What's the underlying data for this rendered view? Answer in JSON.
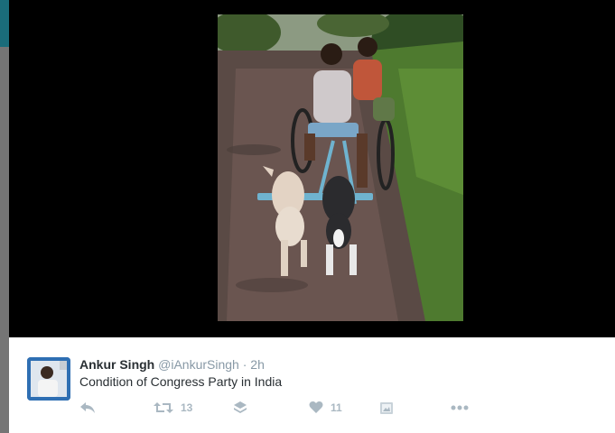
{
  "colors": {
    "backdrop": "#6e6e6e",
    "accent_strip": "#1a6c7a",
    "media_bg": "#000000",
    "tweet_bg": "#ffffff",
    "name_text": "#292f33",
    "meta_text": "#8899a6",
    "action_icon": "#aab8c2"
  },
  "tweet": {
    "author_name": "Ankur Singh",
    "handle": "@iAnkurSingh",
    "separator": "·",
    "time": "2h",
    "text": "Condition of Congress Party in India",
    "actions": {
      "reply_icon": "reply-icon",
      "retweet_icon": "retweet-icon",
      "retweet_count": "13",
      "stack_icon": "stack-icon",
      "like_icon": "heart-icon",
      "like_count": "11",
      "media_icon": "image-icon",
      "more_icon": "more-icon"
    }
  },
  "media": {
    "photo_icon": "photo-image"
  }
}
